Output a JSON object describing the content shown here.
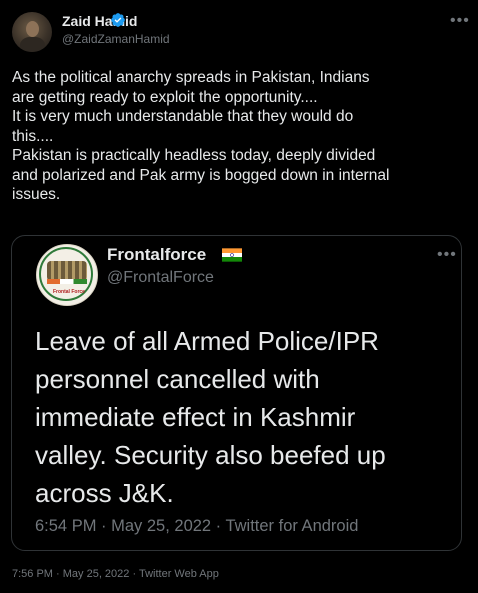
{
  "author": {
    "name": "Zaid Hamid",
    "handle": "@ZaidZamanHamid",
    "verified": true
  },
  "tweet_lines": [
    "As the political anarchy spreads in Pakistan, Indians",
    "are getting ready to exploit the opportunity....",
    "It is very much understandable that they would do",
    "this....",
    "Pakistan is practically headless today, deeply divided",
    "and polarized and Pak army is bogged down in internal",
    "issues."
  ],
  "quote": {
    "name": "Frontalforce",
    "handle": "@FrontalForce",
    "avatar_label": "Frontal Force",
    "text_lines": [
      "Leave of all Armed Police/IPR",
      "personnel cancelled with",
      "immediate effect in Kashmir",
      "valley. Security also beefed up",
      "across J&K."
    ],
    "meta": "6:54 PM · May 25, 2022 · Twitter for Android"
  },
  "footer": "7:56 PM · May 25, 2022 · Twitter Web App",
  "icons": {
    "more": "more-icon",
    "verified": "verified-badge-icon",
    "flag": "india-flag-icon"
  },
  "colors": {
    "background": "#000000",
    "text": "#e7e9ea",
    "secondary": "#71767b",
    "verified": "#1d9bf0",
    "border": "#2f3336"
  }
}
